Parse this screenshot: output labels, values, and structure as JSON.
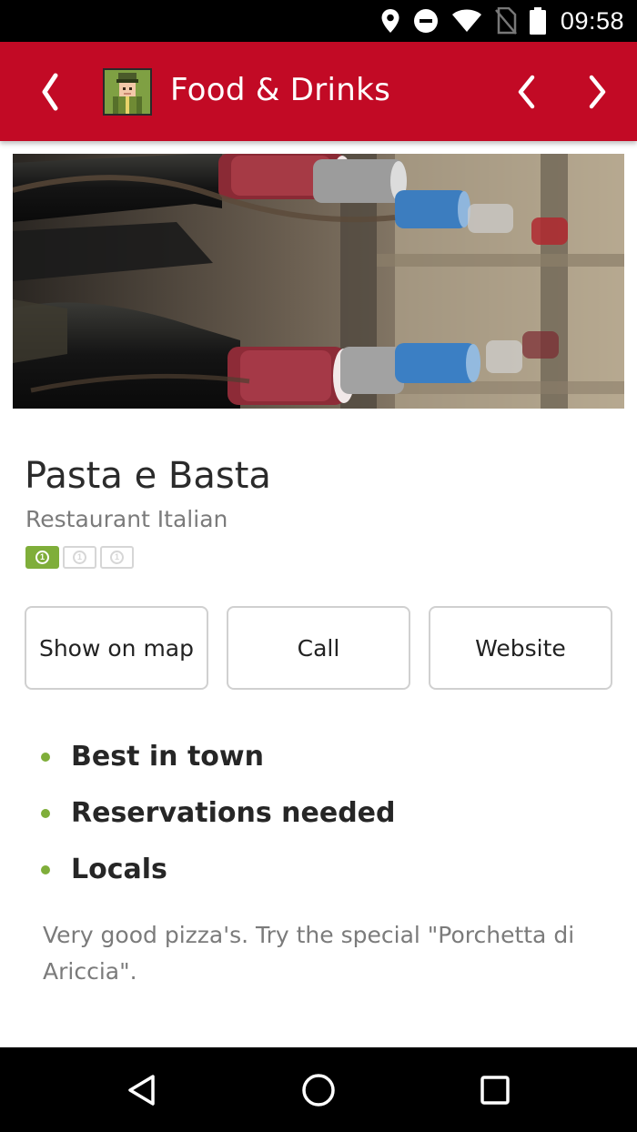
{
  "status_bar": {
    "time": "09:58",
    "icons": [
      "location-icon",
      "do-not-disturb-icon",
      "wifi-icon",
      "no-sim-icon",
      "battery-icon"
    ]
  },
  "app_bar": {
    "title": "Food & Drinks",
    "logo": "concierge-logo",
    "accent_color": "#c20a25"
  },
  "place": {
    "name": "Pasta e Basta",
    "category": "Restaurant Italian",
    "price_level": 1,
    "price_max": 3,
    "price_color": "#7fae3a"
  },
  "actions": {
    "show_on_map": "Show on map",
    "call": "Call",
    "website": "Website"
  },
  "features": [
    "Best in town",
    "Reservations needed",
    "Locals"
  ],
  "description": "Very good pizza's. Try the special \"Porchetta di Ariccia\"."
}
